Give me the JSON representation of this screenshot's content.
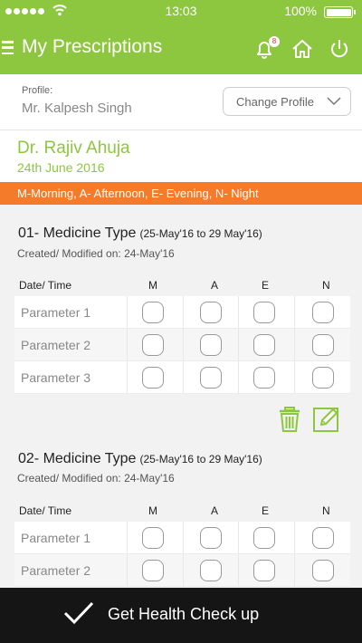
{
  "status_bar": {
    "time": "13:03",
    "battery": "100%"
  },
  "header": {
    "title": "My Prescriptions",
    "notification_count": "8"
  },
  "profile": {
    "label": "Profile:",
    "name": "Mr. Kalpesh Singh",
    "change_label": "Change Profile"
  },
  "doctor": {
    "name": "Dr. Rajiv Ahuja",
    "date": "24th June 2016"
  },
  "legend": "M-Morning, A- Afternoon, E- Evening, N- Night",
  "columns": {
    "datetime": "Date/ Time",
    "m": "M",
    "a": "A",
    "e": "E",
    "n": "N"
  },
  "medicines": [
    {
      "title": "01- Medicine Type",
      "range": "(25-May'16 to 29 May'16)",
      "created": "Created/ Modified on: 24-May'16",
      "parameters": [
        "Parameter 1",
        "Parameter 2",
        "Parameter 3"
      ]
    },
    {
      "title": "02- Medicine Type",
      "range": "(25-May'16 to 29 May'16)",
      "created": "Created/ Modified on: 24-May'16",
      "parameters": [
        "Parameter 1",
        "Parameter 2"
      ]
    }
  ],
  "bottom_bar": {
    "label": "Get Health Check up"
  },
  "colors": {
    "brand_green": "#8dc63f",
    "legend_orange": "#f47b2a",
    "bottom_bar": "#151515"
  },
  "icons": [
    "menu-icon",
    "bell-icon",
    "home-icon",
    "power-icon",
    "chevron-down-icon",
    "trash-icon",
    "edit-icon",
    "check-icon"
  ]
}
